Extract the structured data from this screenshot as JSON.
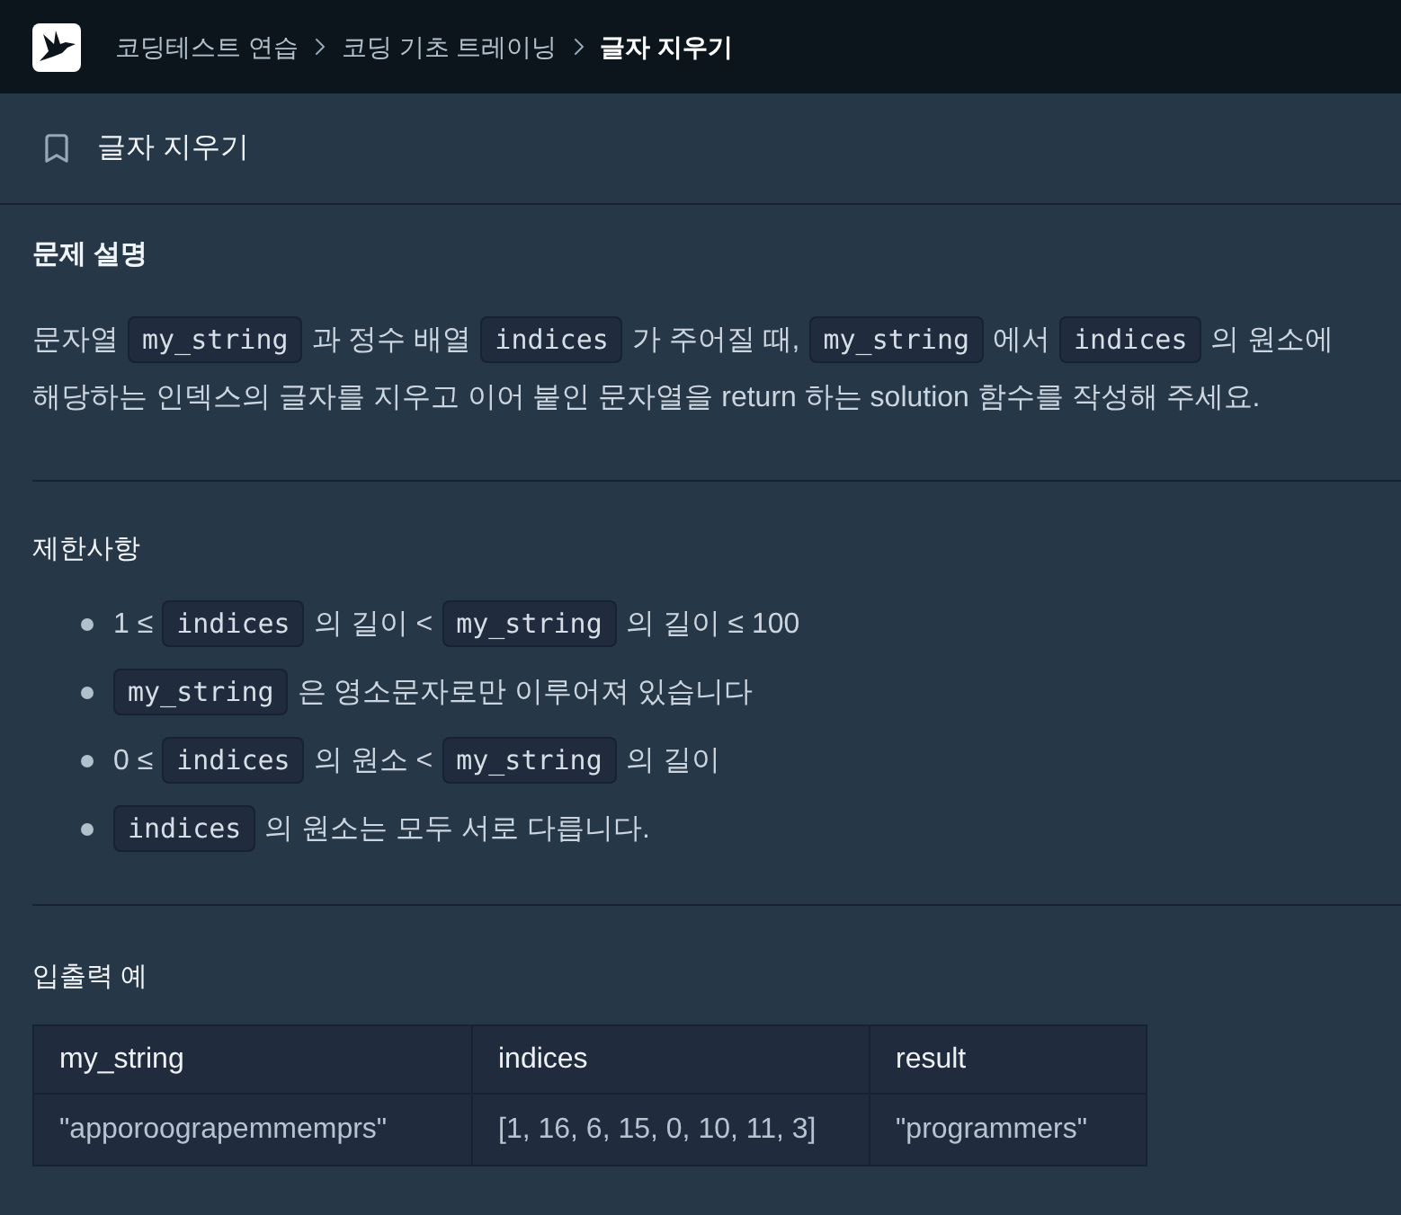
{
  "breadcrumbs": [
    {
      "label": "코딩테스트 연습",
      "current": false
    },
    {
      "label": "코딩 기초 트레이닝",
      "current": false
    },
    {
      "label": "글자 지우기",
      "current": true
    }
  ],
  "title_bar": {
    "title": "글자 지우기"
  },
  "sections": [
    {
      "kind": "paragraph",
      "heading": "문제 설명",
      "segments": [
        {
          "kind": "text",
          "text": "문자열"
        },
        {
          "kind": "code",
          "text": "my_string"
        },
        {
          "kind": "text",
          "text": "과 정수 배열"
        },
        {
          "kind": "code",
          "text": "indices"
        },
        {
          "kind": "text",
          "text": "가 주어질 때,"
        },
        {
          "kind": "code",
          "text": "my_string"
        },
        {
          "kind": "text",
          "text": "에서"
        },
        {
          "kind": "code",
          "text": "indices"
        },
        {
          "kind": "text",
          "text": "의 원소에 해당하는 인덱스의 글자를 지우고 이어 붙인 문자열을 return 하는 solution 함수를 작성해 주세요."
        }
      ]
    },
    {
      "kind": "list",
      "heading": "제한사항",
      "items": [
        {
          "segments": [
            {
              "kind": "text",
              "text": "1 ≤"
            },
            {
              "kind": "code",
              "text": "indices"
            },
            {
              "kind": "text",
              "text": "의 길이 <"
            },
            {
              "kind": "code",
              "text": "my_string"
            },
            {
              "kind": "text",
              "text": "의 길이 ≤ 100"
            }
          ]
        },
        {
          "segments": [
            {
              "kind": "code",
              "text": "my_string"
            },
            {
              "kind": "text",
              "text": "은 영소문자로만 이루어져 있습니다"
            }
          ]
        },
        {
          "segments": [
            {
              "kind": "text",
              "text": "0 ≤"
            },
            {
              "kind": "code",
              "text": "indices"
            },
            {
              "kind": "text",
              "text": "의 원소 <"
            },
            {
              "kind": "code",
              "text": "my_string"
            },
            {
              "kind": "text",
              "text": "의 길이"
            }
          ]
        },
        {
          "segments": [
            {
              "kind": "code",
              "text": "indices"
            },
            {
              "kind": "text",
              "text": "의 원소는 모두 서로 다릅니다."
            }
          ]
        }
      ]
    },
    {
      "kind": "table",
      "heading": "입출력 예",
      "columns": [
        "my_string",
        "indices",
        "result"
      ],
      "rows": [
        [
          "\"apporoograpemmemprs\"",
          "[1, 16, 6, 15, 0, 10, 11, 3]",
          "\"programmers\""
        ]
      ]
    }
  ]
}
